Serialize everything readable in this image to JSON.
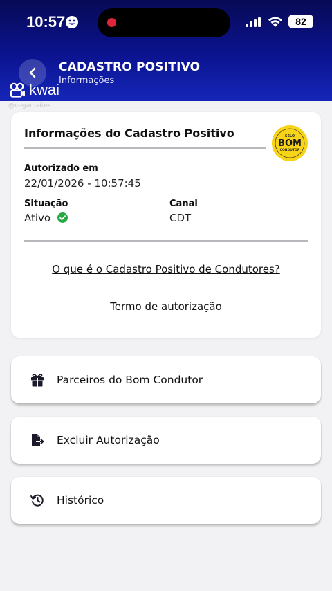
{
  "status_bar": {
    "time": "10:57",
    "battery": "82"
  },
  "header": {
    "title": "CADASTRO POSITIVO",
    "subtitle": "Informações"
  },
  "watermark": {
    "brand": "kwai",
    "user": "@vegamaites"
  },
  "info_card": {
    "title": "Informações do Cadastro Positivo",
    "seal": {
      "top_text": "SELO",
      "main_text": "BOM",
      "bottom_text": "CONDUTOR",
      "color": "#f7d417"
    },
    "authorized_label": "Autorizado em",
    "authorized_value": "22/01/2026 - 10:57:45",
    "status_label": "Situação",
    "status_value": "Ativo",
    "channel_label": "Canal",
    "channel_value": "CDT",
    "link_about": "O que é o Cadastro Positivo de Condutores?",
    "link_terms": "Termo de autorização"
  },
  "menu": [
    {
      "label": "Parceiros do Bom Condutor",
      "icon": "gift-icon"
    },
    {
      "label": "Excluir Autorização",
      "icon": "file-export-icon"
    },
    {
      "label": "Histórico",
      "icon": "history-icon"
    }
  ],
  "colors": {
    "header_dark": "#070a55",
    "header_light": "#1526b8",
    "status_active": "#27a844",
    "background": "#f2f2f4"
  }
}
